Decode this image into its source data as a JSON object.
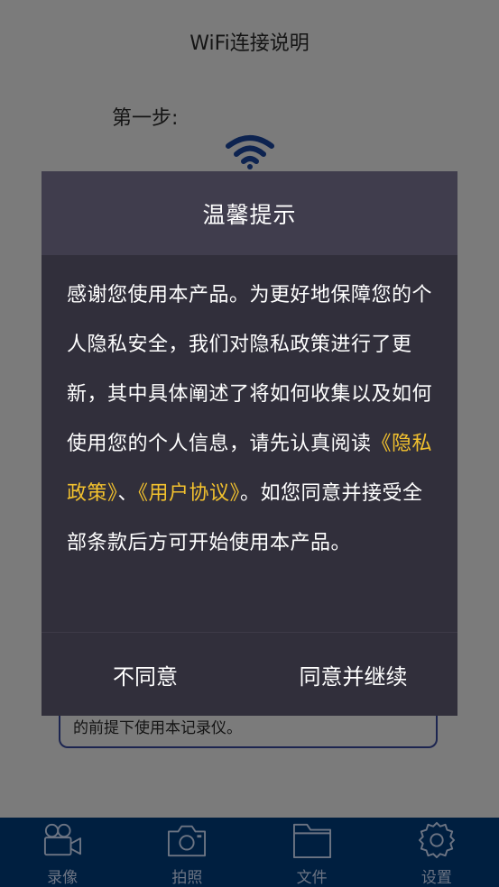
{
  "page": {
    "title": "WiFi连接说明",
    "step_label": "第一步:",
    "info_text": "的前提下使用本记录仪。"
  },
  "dialog": {
    "title": "温馨提示",
    "body_part1": "感谢您使用本产品。为更好地保障您的个人隐私安全，我们对隐私政策进行了更新，其中具体阐述了将如何收集以及如何使用您的个人信息，请先认真阅读",
    "privacy_link": "《隐私政策》",
    "separator": "、",
    "terms_link": "《用户协议》",
    "body_part2": "。如您同意并接受全部条款后方可开始使用本产品。",
    "disagree_label": "不同意",
    "agree_label": "同意并继续"
  },
  "nav": {
    "items": [
      {
        "label": "录像",
        "icon": "video-camera-icon"
      },
      {
        "label": "拍照",
        "icon": "camera-icon"
      },
      {
        "label": "文件",
        "icon": "folder-icon"
      },
      {
        "label": "设置",
        "icon": "gear-icon"
      }
    ]
  },
  "colors": {
    "overlay_bg": "#7b7b7b",
    "dialog_bg": "#312f3b",
    "dialog_header_bg": "#403d4d",
    "link": "#f2c12e",
    "nav_bg": "#001f40",
    "nav_inactive": "#6c7483"
  }
}
